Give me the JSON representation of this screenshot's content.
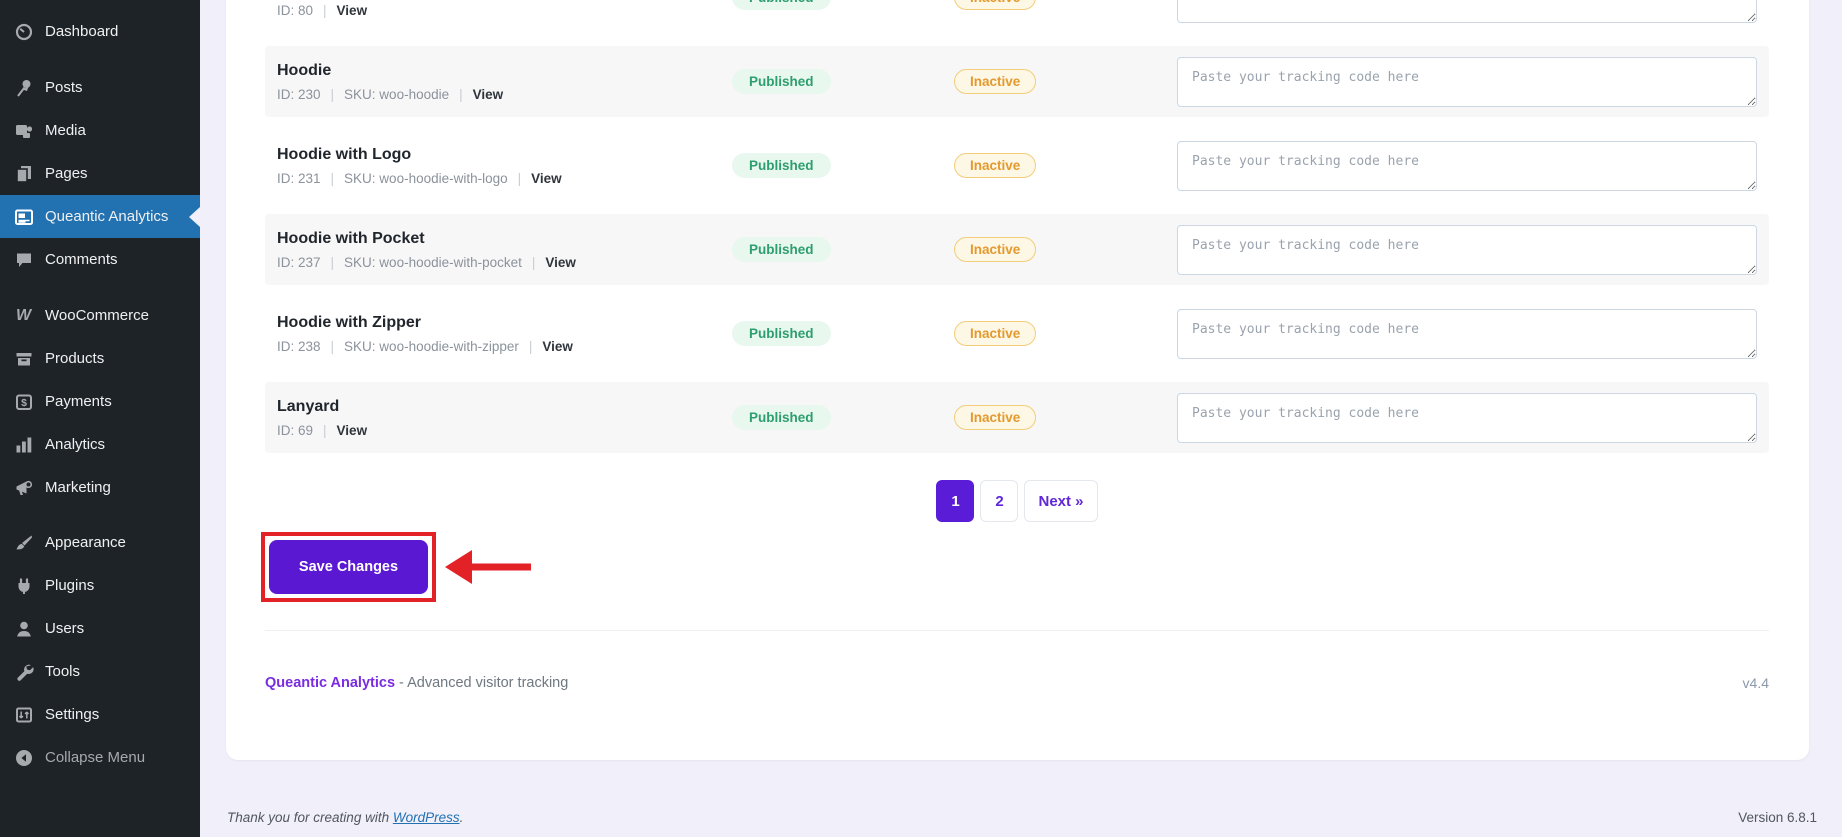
{
  "sidebar": {
    "items": [
      {
        "label": "Dashboard",
        "icon": "dashboard-icon",
        "active": false
      },
      {
        "label": "Posts",
        "icon": "pushpin-icon",
        "active": false
      },
      {
        "label": "Media",
        "icon": "media-icon",
        "active": false
      },
      {
        "label": "Pages",
        "icon": "pages-icon",
        "active": false
      },
      {
        "label": "Queantic Analytics",
        "icon": "analytics-plugin-icon",
        "active": true
      },
      {
        "label": "Comments",
        "icon": "comment-icon",
        "active": false
      },
      {
        "label": "WooCommerce",
        "icon": "woocommerce-icon",
        "active": false
      },
      {
        "label": "Products",
        "icon": "products-box-icon",
        "active": false
      },
      {
        "label": "Payments",
        "icon": "payments-icon",
        "active": false
      },
      {
        "label": "Analytics",
        "icon": "bar-chart-icon",
        "active": false
      },
      {
        "label": "Marketing",
        "icon": "megaphone-icon",
        "active": false
      },
      {
        "label": "Appearance",
        "icon": "brush-icon",
        "active": false
      },
      {
        "label": "Plugins",
        "icon": "plugin-icon",
        "active": false
      },
      {
        "label": "Users",
        "icon": "user-icon",
        "active": false
      },
      {
        "label": "Tools",
        "icon": "wrench-icon",
        "active": false
      },
      {
        "label": "Settings",
        "icon": "settings-icon",
        "active": false
      },
      {
        "label": "Collapse Menu",
        "icon": "collapse-arrow-icon",
        "active": false
      }
    ],
    "woocommerce_glyph": "W"
  },
  "products": {
    "view_label": "View",
    "meta_separator": "|",
    "placeholder": "Paste your tracking code here",
    "rows": [
      {
        "title": "",
        "id_label": "ID: 80",
        "sku_label": null,
        "status": "Published",
        "tracking": "Inactive"
      },
      {
        "title": "Hoodie",
        "id_label": "ID: 230",
        "sku_label": "SKU: woo-hoodie",
        "status": "Published",
        "tracking": "Inactive"
      },
      {
        "title": "Hoodie with Logo",
        "id_label": "ID: 231",
        "sku_label": "SKU: woo-hoodie-with-logo",
        "status": "Published",
        "tracking": "Inactive"
      },
      {
        "title": "Hoodie with Pocket",
        "id_label": "ID: 237",
        "sku_label": "SKU: woo-hoodie-with-pocket",
        "status": "Published",
        "tracking": "Inactive"
      },
      {
        "title": "Hoodie with Zipper",
        "id_label": "ID: 238",
        "sku_label": "SKU: woo-hoodie-with-zipper",
        "status": "Published",
        "tracking": "Inactive"
      },
      {
        "title": "Lanyard",
        "id_label": "ID: 69",
        "sku_label": null,
        "status": "Published",
        "tracking": "Inactive"
      }
    ]
  },
  "pagination": {
    "page_1": "1",
    "page_2": "2",
    "next_label": "Next »",
    "current_page": "1"
  },
  "save": {
    "label": "Save Changes"
  },
  "plugin_footer": {
    "name": "Queantic Analytics",
    "separator": "-",
    "tagline": "Advanced visitor tracking",
    "version": "v4.4"
  },
  "wp_footer": {
    "thanks_prefix": "Thank you for creating with ",
    "link_label": "WordPress",
    "thanks_suffix": ".",
    "version": "Version 6.8.1"
  },
  "colors": {
    "sidebar_bg": "#1d2327",
    "active_menu_blue": "#2271b1",
    "page_bg": "#f1effa",
    "accent_purple": "#5a1cd6",
    "published_text": "#2e9e6f",
    "published_bg": "#e8f8ef",
    "inactive_text": "#e4992e",
    "inactive_border": "#f3cd7a",
    "inactive_bg": "#fdf7e6",
    "annotation_red": "#e32228",
    "link_blue": "#2271b1"
  }
}
